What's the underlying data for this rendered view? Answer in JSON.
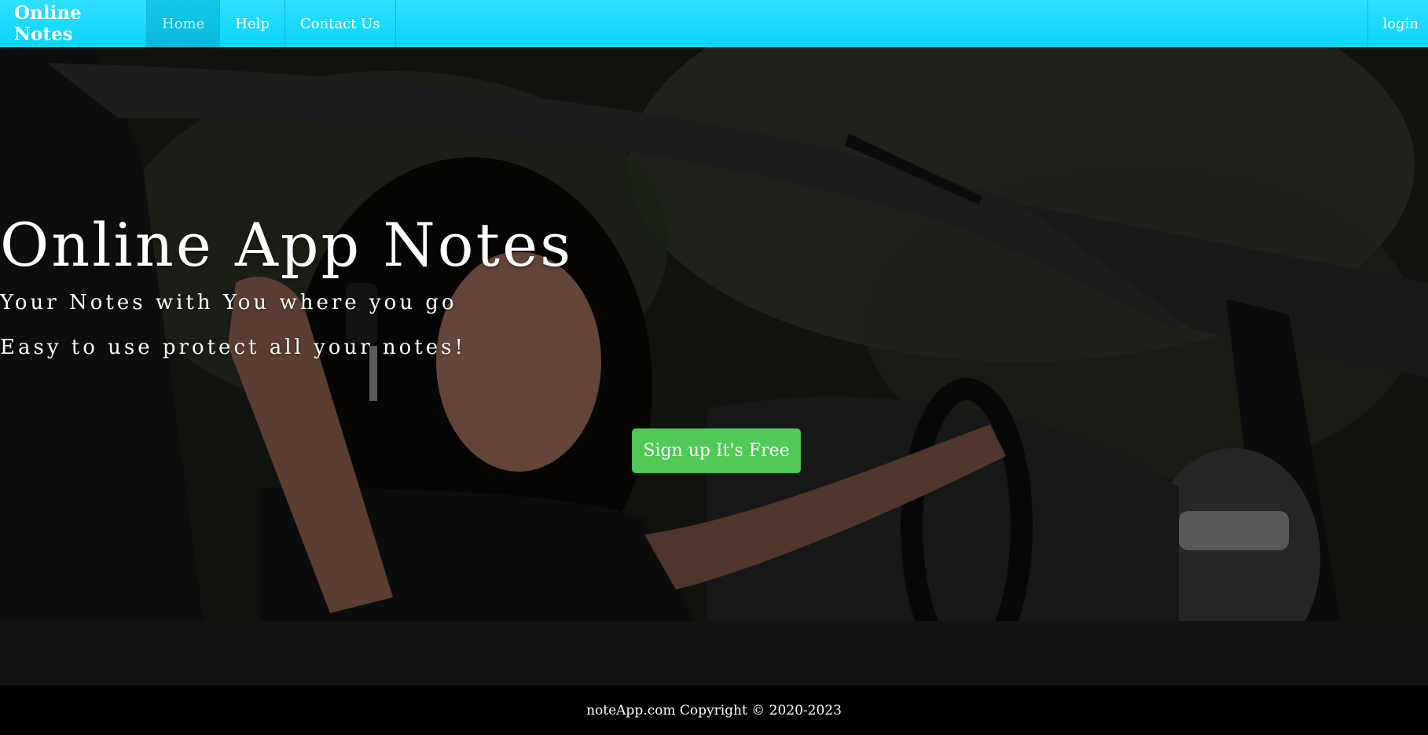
{
  "navbar": {
    "brand": "Online Notes",
    "items": [
      {
        "label": "Home",
        "active": true
      },
      {
        "label": "Help",
        "active": false
      },
      {
        "label": "Contact Us",
        "active": false
      }
    ],
    "login_label": "login",
    "color": "#0cd4f8"
  },
  "hero": {
    "title": "Online App Notes",
    "subtitle_1": "Your Notes with You where you go",
    "subtitle_2": "Easy to use protect all your notes!",
    "signup_label": "Sign up It's Free",
    "signup_color": "#50c957"
  },
  "footer": {
    "copyright": "noteApp.com Copyright © 2020-2023"
  }
}
